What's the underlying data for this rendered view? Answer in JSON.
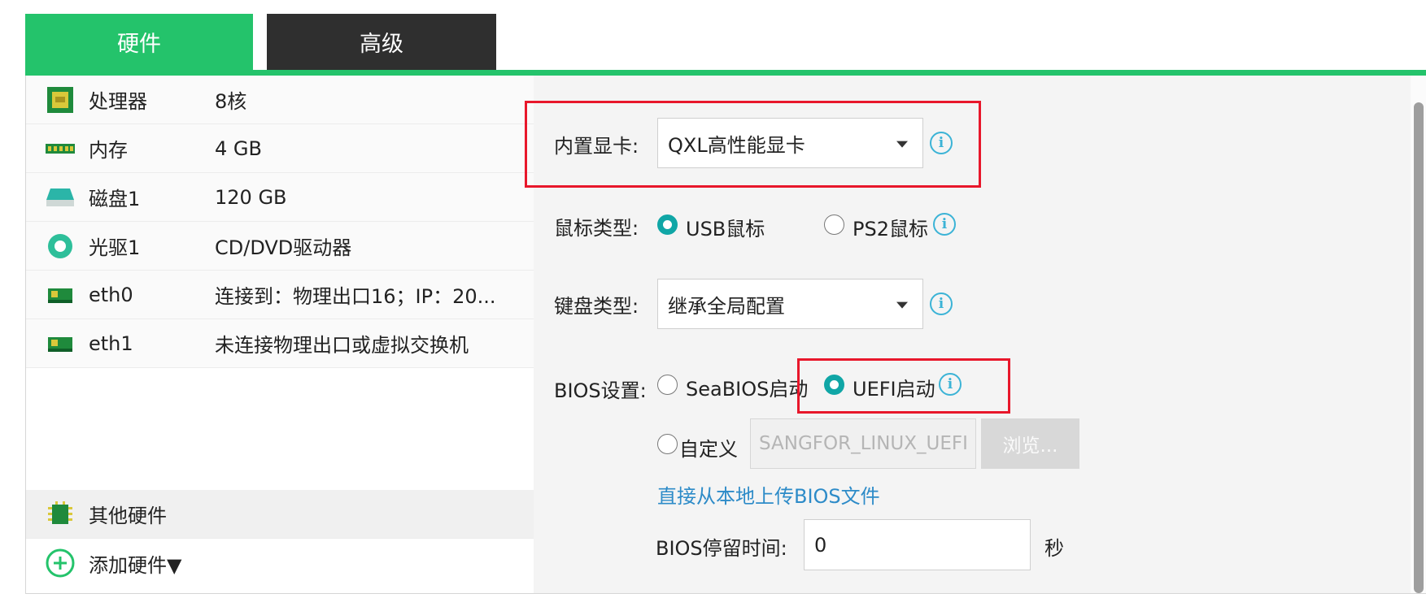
{
  "tabs": [
    {
      "label": "硬件",
      "active": true
    },
    {
      "label": "高级",
      "active": false
    }
  ],
  "colors": {
    "accent": "#24c36b",
    "dark_tab": "#2f2f2f",
    "highlight_box": "#e8172b",
    "radio_on": "#10a6a6",
    "link": "#2d8bc8",
    "info": "#3bb3d6"
  },
  "hardware": [
    {
      "name": "处理器",
      "value": "8核",
      "icon": "cpu-icon"
    },
    {
      "name": "内存",
      "value": "4 GB",
      "icon": "memory-icon"
    },
    {
      "name": "磁盘1",
      "value": "120 GB",
      "icon": "disk-icon"
    },
    {
      "name": "光驱1",
      "value": "CD/DVD驱动器",
      "icon": "cdrom-icon"
    },
    {
      "name": "eth0",
      "value": "连接到：物理出口16；IP：20...",
      "icon": "network-card-icon"
    },
    {
      "name": "eth1",
      "value": "未连接物理出口或虚拟交换机",
      "icon": "network-card-icon"
    }
  ],
  "other_hardware": {
    "label": "其他硬件",
    "icon": "chip-icon"
  },
  "add_hardware": {
    "label": "添加硬件▼",
    "icon": "add-circle-icon"
  },
  "form": {
    "gpu": {
      "label": "内置显卡:",
      "value": "QXL高性能显卡"
    },
    "mouse": {
      "label": "鼠标类型:",
      "options": [
        "USB鼠标",
        "PS2鼠标"
      ],
      "selected": "USB鼠标"
    },
    "keyboard": {
      "label": "键盘类型:",
      "value": "继承全局配置"
    },
    "bios": {
      "label": "BIOS设置:",
      "options": [
        "SeaBIOS启动",
        "UEFI启动"
      ],
      "selected": "UEFI启动",
      "custom_label": "自定义",
      "custom_value": "SANGFOR_LINUX_UEFI",
      "browse_label": "浏览...",
      "upload_link": "直接从本地上传BIOS文件"
    },
    "bios_wait": {
      "label": "BIOS停留时间:",
      "value": "0",
      "unit": "秒"
    }
  }
}
